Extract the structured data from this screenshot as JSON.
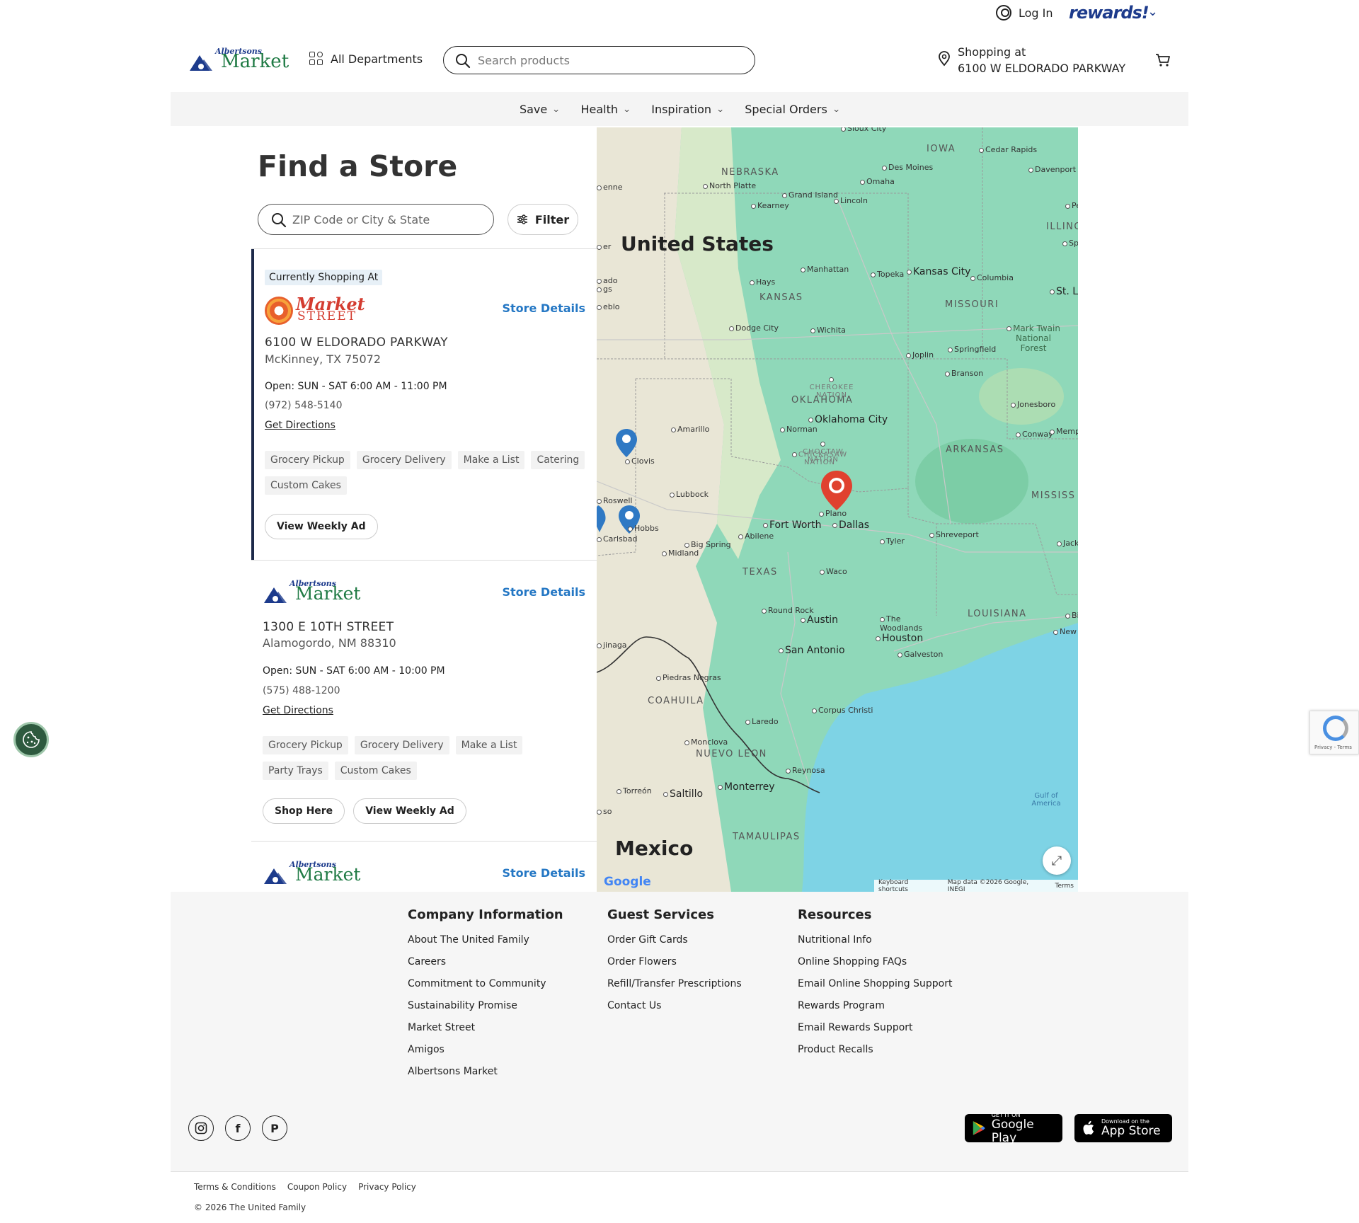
{
  "header": {
    "login_label": "Log In",
    "rewards_label": "rewards!",
    "logo_small": "Albertsons",
    "logo_big": "Market",
    "all_departments": "All Departments",
    "search_placeholder": "Search products",
    "shopping_at_label": "Shopping at",
    "shopping_at_store": "6100 W ELDORADO PARKWAY"
  },
  "nav": {
    "items": [
      "Save",
      "Health",
      "Inspiration",
      "Special Orders"
    ]
  },
  "finder": {
    "title": "Find a Store",
    "zip_placeholder": "ZIP Code or City & State",
    "filter_label": "Filter",
    "current_badge": "Currently Shopping At",
    "store_details_label": "Store Details",
    "get_directions_label": "Get Directions",
    "stores": [
      {
        "banner_line1": "Market",
        "banner_line2": "STREET",
        "address": "6100 W ELDORADO PARKWAY",
        "city": "McKinney, TX 75072",
        "hours": "Open: SUN - SAT 6:00 AM - 11:00 PM",
        "phone": "(972) 548-5140",
        "services": [
          "Grocery Pickup",
          "Grocery Delivery",
          "Make a List",
          "Catering",
          "Custom Cakes"
        ],
        "buttons": [
          "View Weekly Ad"
        ]
      },
      {
        "banner_small": "Albertsons",
        "banner_big": "Market",
        "address": "1300 E 10TH STREET",
        "city": "Alamogordo, NM 88310",
        "hours": "Open: SUN - SAT 6:00 AM - 10:00 PM",
        "phone": "(575) 488-1200",
        "services": [
          "Grocery Pickup",
          "Grocery Delivery",
          "Make a List",
          "Party Trays",
          "Custom Cakes"
        ],
        "buttons": [
          "Shop Here",
          "View Weekly Ad"
        ]
      },
      {
        "banner_small": "Albertsons",
        "banner_big": "Market"
      }
    ]
  },
  "map": {
    "countries": [
      "United States",
      "Mexico"
    ],
    "states": [
      "NEBRASKA",
      "IOWA",
      "KANSAS",
      "MISSOURI",
      "ILLINO",
      "OKLAHOMA",
      "ARKANSAS",
      "MISSISS",
      "TEXAS",
      "LOUISIANA",
      "COAHUILA",
      "NUEVO LEON",
      "TAMAULIPAS"
    ],
    "nations": [
      "CHEROKEE NATION",
      "CHOCTAW NATION",
      "CHICKASAW NATION"
    ],
    "major_cities": [
      "Kansas City",
      "Oklahoma City",
      "Fort Worth",
      "Dallas",
      "Austin",
      "San Antonio",
      "Houston",
      "Monterrey",
      "Saltillo",
      "St. Lo"
    ],
    "minor_cities": [
      "Sioux City",
      "Cedar Rapids",
      "Des Moines",
      "Davenport",
      "Omaha",
      "North Platte",
      "Grand Island",
      "Lincoln",
      "Kearney",
      "Pe",
      "Spi",
      "Manhattan",
      "Topeka",
      "Columbia",
      "Hays",
      "Dodge City",
      "Wichita",
      "Joplin",
      "Springfield",
      "Branson",
      "Mark Twain National Forest",
      "Jonesboro",
      "Conway",
      "Memph",
      "Norman",
      "Amarillo",
      "Clovis",
      "Lubbock",
      "Roswell",
      "Hobbs",
      "Carlsbad",
      "Big Spring",
      "Midland",
      "Abilene",
      "Plano",
      "Tyler",
      "Shreveport",
      "Jackson",
      "Waco",
      "Round Rock",
      "The Woodlands",
      "Galveston",
      "New O",
      "Bilo",
      "Piedras Negras",
      "Laredo",
      "Corpus Christi",
      "Monclova",
      "Reynosa",
      "Torreón",
      "jinaga",
      "ado",
      "gs",
      "eblo",
      "enne",
      "er",
      "so"
    ],
    "water_label": "Gulf of America",
    "google_label": "Google",
    "attribution": [
      "Keyboard shortcuts",
      "Map data ©2026 Google, INEGI",
      "Terms"
    ]
  },
  "footer": {
    "columns": [
      {
        "title": "Company Information",
        "links": [
          "About The United Family",
          "Careers",
          "Commitment to Community",
          "Sustainability Promise",
          "Market Street",
          "Amigos",
          "Albertsons Market"
        ]
      },
      {
        "title": "Guest Services",
        "links": [
          "Order Gift Cards",
          "Order Flowers",
          "Refill/Transfer Prescriptions",
          "Contact Us"
        ]
      },
      {
        "title": "Resources",
        "links": [
          "Nutritional Info",
          "Online Shopping FAQs",
          "Email Online Shopping Support",
          "Rewards Program",
          "Email Rewards Support",
          "Product Recalls"
        ]
      }
    ],
    "google_play": {
      "line1": "GET IT ON",
      "line2": "Google Play"
    },
    "app_store": {
      "line1": "Download on the",
      "line2": "App Store"
    },
    "legal": [
      "Terms & Conditions",
      "Coupon Policy",
      "Privacy Policy"
    ],
    "copyright": "© 2026 The United Family"
  },
  "recaptcha_text": "Privacy - Terms",
  "colors": {
    "brand_blue": "#1d3b8c",
    "brand_green": "#1f7a44",
    "link_blue": "#2477c4",
    "market_street_red": "#d43c30"
  }
}
